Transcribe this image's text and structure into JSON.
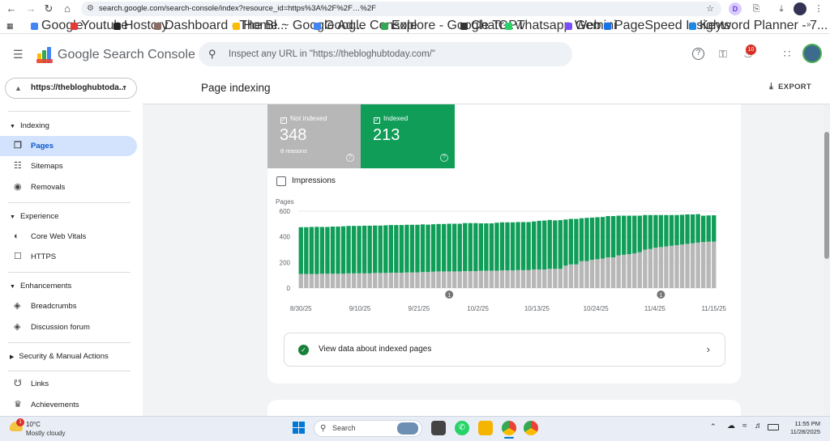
{
  "browser": {
    "url": "search.google.com/search-console/index?resource_id=https%3A%2F%2F…%2F",
    "profile_initial": "D",
    "bookmarks": [
      "Google",
      "Youtube",
      "Hostcry",
      "Dashboard ‹ The Bl...",
      "Home ~ Google Ad...",
      "Google Console",
      "Explore - Google Tr...",
      "ChatGPT",
      "whatsapp Web",
      "Gemini",
      "PageSpeed Insights",
      "Keyword Planner - 7..."
    ],
    "bookmark_colors": [
      "#4285f4",
      "#e53935",
      "#222222",
      "#8d6e63",
      "#fbbc04",
      "#4285f4",
      "#34a853",
      "#333333",
      "#25d366",
      "#7c4dff",
      "#1a73e8",
      "#1e88e5"
    ]
  },
  "header": {
    "app_name": "Google Search Console",
    "search_placeholder": "Inspect any URL in \"https://thebloghubtoday.com/\"",
    "notification_count": "10"
  },
  "sidebar": {
    "property": "https://thebloghubtoda...",
    "sections": {
      "indexing": "Indexing",
      "experience": "Experience",
      "enhancements": "Enhancements",
      "security": "Security & Manual Actions"
    },
    "items": {
      "pages": "Pages",
      "sitemaps": "Sitemaps",
      "removals": "Removals",
      "cwv": "Core Web Vitals",
      "https": "HTTPS",
      "breadcrumbs": "Breadcrumbs",
      "discussion": "Discussion forum",
      "links": "Links",
      "achievements": "Achievements"
    }
  },
  "main": {
    "title": "Page indexing",
    "export_label": "EXPORT",
    "not_indexed": {
      "label": "Not indexed",
      "value": "348",
      "sub": "8 reasons"
    },
    "indexed": {
      "label": "Indexed",
      "value": "213"
    },
    "impressions_label": "Impressions",
    "view_data_label": "View data about indexed pages",
    "annotation_label": "1"
  },
  "chart_data": {
    "type": "bar",
    "stacked": true,
    "ylabel": "Pages",
    "ylim": [
      0,
      600
    ],
    "yticks": [
      0,
      200,
      400,
      600
    ],
    "xtick_labels": [
      "8/30/25",
      "9/10/25",
      "9/21/25",
      "10/2/25",
      "10/13/25",
      "10/24/25",
      "11/4/25",
      "11/15/25"
    ],
    "series": [
      {
        "name": "Not indexed",
        "color": "#b7b7b7",
        "values": [
          110,
          110,
          110,
          110,
          112,
          112,
          112,
          112,
          112,
          115,
          115,
          115,
          115,
          115,
          118,
          118,
          118,
          120,
          120,
          120,
          122,
          122,
          122,
          125,
          125,
          128,
          130,
          130,
          130,
          130,
          130,
          132,
          132,
          132,
          135,
          135,
          135,
          135,
          138,
          138,
          138,
          140,
          140,
          140,
          145,
          145,
          145,
          150,
          150,
          150,
          175,
          185,
          185,
          210,
          210,
          220,
          225,
          230,
          240,
          240,
          255,
          260,
          265,
          270,
          280,
          300,
          305,
          315,
          320,
          325,
          330,
          335,
          340,
          345,
          350,
          355,
          360,
          362,
          363
        ]
      },
      {
        "name": "Indexed",
        "color": "#0f9d58",
        "values": [
          365,
          365,
          367,
          368,
          365,
          365,
          368,
          368,
          370,
          370,
          370,
          370,
          372,
          372,
          370,
          370,
          372,
          372,
          372,
          372,
          372,
          372,
          372,
          372,
          370,
          370,
          370,
          370,
          372,
          372,
          372,
          375,
          375,
          375,
          370,
          370,
          370,
          375,
          375,
          375,
          375,
          375,
          375,
          375,
          375,
          380,
          382,
          382,
          378,
          380,
          360,
          355,
          355,
          335,
          338,
          330,
          328,
          325,
          322,
          322,
          310,
          305,
          300,
          295,
          285,
          270,
          265,
          255,
          250,
          245,
          240,
          235,
          232,
          230,
          225,
          222,
          205,
          205,
          205
        ]
      }
    ],
    "annotations": [
      {
        "x_index": 28,
        "label": "1"
      },
      {
        "x_index": 68,
        "label": "1"
      }
    ]
  },
  "taskbar": {
    "temp": "10°C",
    "weather": "Mostly cloudy",
    "weather_badge": "1",
    "search_label": "Search",
    "time": "11:55 PM",
    "date": "11/28/2025"
  }
}
